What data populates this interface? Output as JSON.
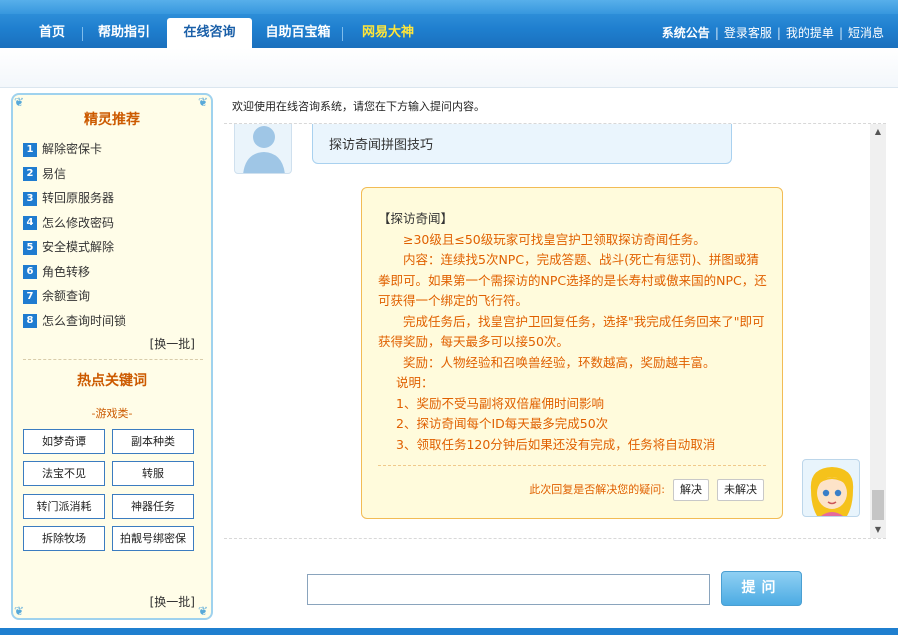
{
  "nav": {
    "tabs": [
      {
        "label": "首页"
      },
      {
        "label": "帮助指引"
      },
      {
        "label": "在线咨询"
      },
      {
        "label": "自助百宝箱"
      },
      {
        "label": "网易大神"
      }
    ],
    "links": [
      "系统公告",
      "登录客服",
      "我的提单",
      "短消息"
    ]
  },
  "sidebar": {
    "recommend_title": "精灵推荐",
    "recommend_items": [
      "解除密保卡",
      "易信",
      "转回原服务器",
      "怎么修改密码",
      "安全模式解除",
      "角色转移",
      "余额查询",
      "怎么查询时间锁"
    ],
    "swap_label": "[换一批]",
    "hot_title": "热点关键词",
    "category": "-游戏类-",
    "keywords": [
      "如梦奇谭",
      "副本种类",
      "法宝不见",
      "转服",
      "转门派消耗",
      "神器任务",
      "拆除牧场",
      "拍靓号绑密保"
    ],
    "swap_label_2": "[换一批]"
  },
  "main": {
    "welcome": "欢迎使用在线咨询系统，请您在下方输入提问内容。",
    "user_question": "探访奇闻拼图技巧",
    "answer": {
      "title": "【探访奇闻】",
      "line1": "≥30级且≤50级玩家可找皇宫护卫领取探访奇闻任务。",
      "line2": "内容：连续找5次NPC，完成答题、战斗(死亡有惩罚)、拼图或猜拳即可。如果第一个需探访的NPC选择的是长寿村或傲来国的NPC，还可获得一个绑定的飞行符。",
      "line3": "完成任务后，找皇宫护卫回复任务，选择\"我完成任务回来了\"即可获得奖励，每天最多可以接50次。",
      "line4": "奖励：人物经验和召唤兽经验，环数越高，奖励越丰富。",
      "notes_title": "说明：",
      "notes": [
        "1、奖励不受马副将双倍雇佣时间影响",
        "2、探访奇闻每个ID每天最多完成50次",
        "3、领取任务120分钟后如果还没有完成，任务将自动取消"
      ],
      "feedback_q": "此次回复是否解决您的疑问:",
      "resolved": "解决",
      "unresolved": "未解决"
    },
    "ask_placeholder": "",
    "ask_button": "提问"
  },
  "colors": {
    "nav_blue": "#1f7fcf",
    "accent_orange": "#e06000",
    "gold": "#ffe63a",
    "number_badge": "#1f7cd0"
  }
}
